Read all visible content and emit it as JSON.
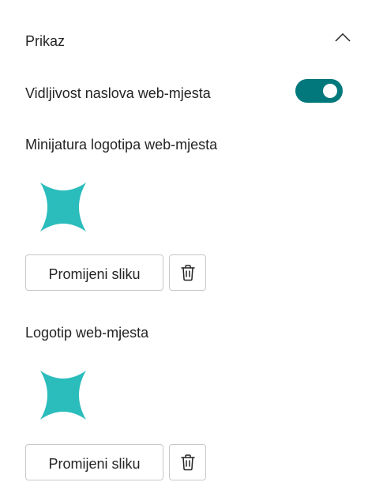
{
  "section": {
    "title": "Prikaz",
    "expanded": true
  },
  "site_title_toggle": {
    "label": "Vidljivost naslova web-mjesta",
    "on": true,
    "color": "#03787c"
  },
  "logo_thumbnail": {
    "label": "Minijatura logotipa web-mjesta",
    "change_label": "Promijeni sliku",
    "delete_icon": "trash-icon"
  },
  "site_logo": {
    "label": "Logotip web-mjesta",
    "change_label": "Promijeni sliku",
    "delete_icon": "trash-icon"
  },
  "logo_color": "#2bbcbc"
}
